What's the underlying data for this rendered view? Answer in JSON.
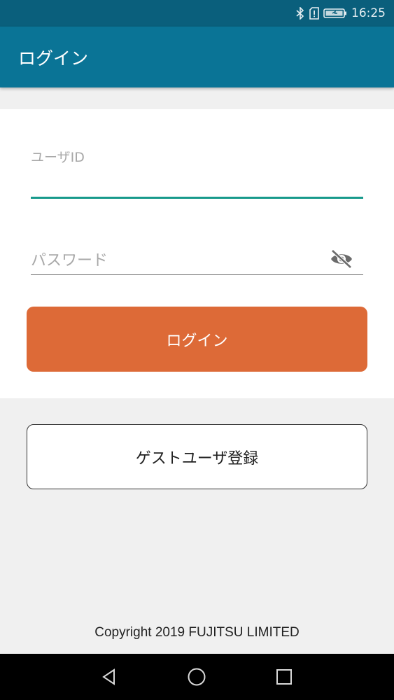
{
  "status_bar": {
    "time": "16:25",
    "icons": [
      "bluetooth-icon",
      "sim-alert-icon",
      "battery-charging-icon"
    ]
  },
  "app_bar": {
    "title": "ログイン"
  },
  "login_form": {
    "user_id_placeholder": "ユーザID",
    "user_id_value": "",
    "password_placeholder": "パスワード",
    "password_value": "",
    "password_toggle_icon": "eye-off-icon",
    "login_button_label": "ログイン"
  },
  "guest": {
    "register_button_label": "ゲストユーザ登録"
  },
  "footer": {
    "copyright": "Copyright 2019 FUJITSU LIMITED"
  },
  "nav_bar": {
    "buttons": [
      "back-icon",
      "home-icon",
      "recents-icon"
    ]
  },
  "colors": {
    "status_bar": "#0a5f7c",
    "app_bar": "#0a7496",
    "accent_underline": "#179a8c",
    "login_button": "#dd6a37",
    "background": "#f0f0f0"
  }
}
